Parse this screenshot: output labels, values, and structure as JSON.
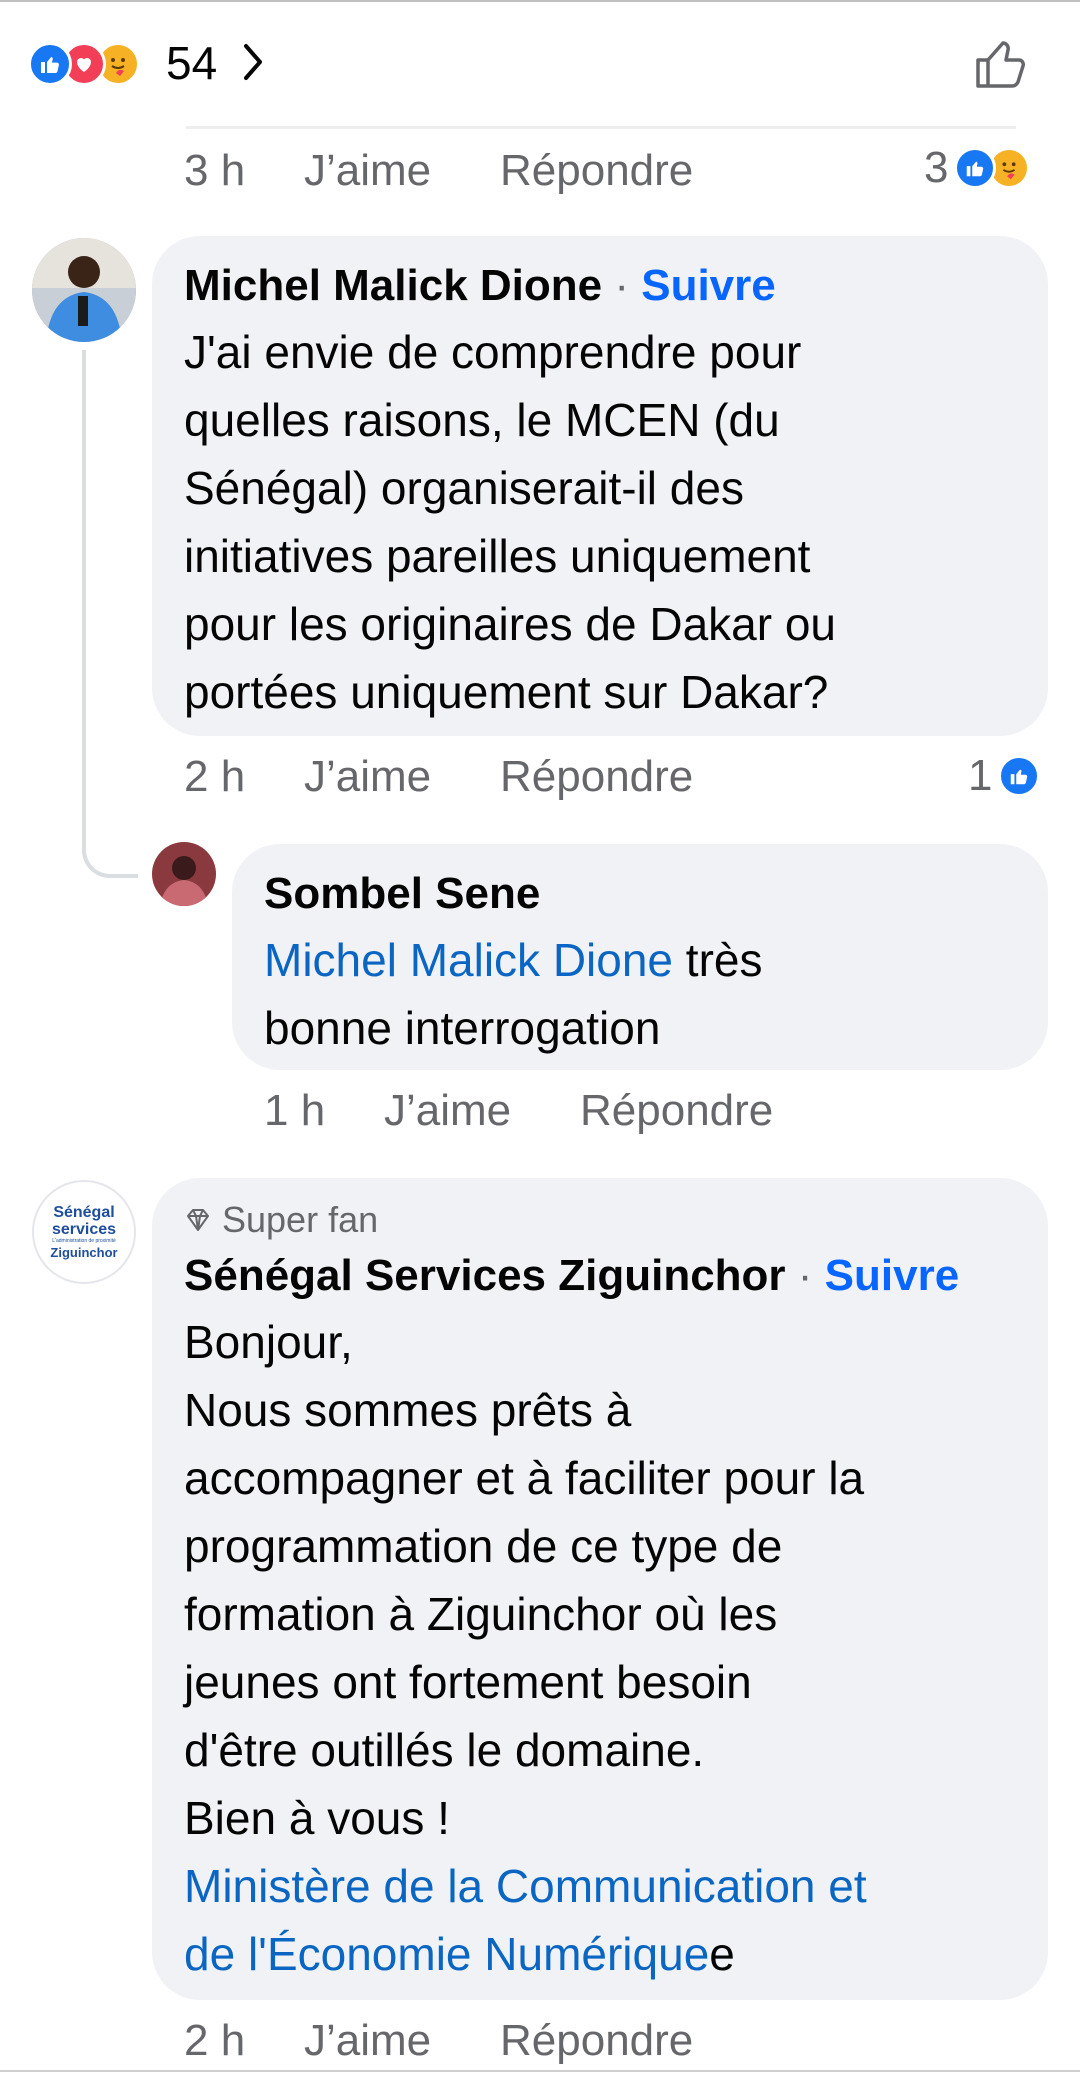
{
  "header": {
    "reaction_count": "54",
    "reaction_icons": [
      "like-icon",
      "love-icon",
      "care-icon"
    ]
  },
  "comments": [
    {
      "meta": {
        "time": "3 h",
        "like": "J’aime",
        "reply": "Répondre"
      },
      "reactions": {
        "count": "3",
        "icons": [
          "like-icon",
          "care-icon"
        ]
      }
    },
    {
      "author": "Michel Malick Dione",
      "separator": "·",
      "follow": "Suivre",
      "lines": [
        "J'ai envie de comprendre pour",
        "quelles raisons, le MCEN (du",
        "Sénégal) organiserait-il des",
        "initiatives pareilles uniquement",
        "pour les originaires de Dakar ou",
        "portées uniquement sur Dakar?"
      ],
      "meta": {
        "time": "2 h",
        "like": "J’aime",
        "reply": "Répondre"
      },
      "reactions": {
        "count": "1",
        "icons": [
          "like-icon"
        ]
      }
    },
    {
      "author": "Sombel Sene",
      "mention": "Michel Malick Dione",
      "line1_rest": " très",
      "line2": "bonne interrogation",
      "meta": {
        "time": "1 h",
        "like": "J’aime",
        "reply": "Répondre"
      }
    },
    {
      "badge": "Super fan",
      "author": "Sénégal Services Ziguinchor",
      "separator": "·",
      "follow": "Suivre",
      "avatar_logo": {
        "line1": "Sénégal",
        "line2": "services",
        "tag": "L'administration de proximité",
        "city": "Ziguinchor"
      },
      "lines": [
        "Bonjour,",
        "Nous sommes prêts à",
        "accompagner et à faciliter pour la",
        "programmation de ce type de",
        "formation à Ziguinchor où les",
        "jeunes ont fortement besoin",
        "d'être outillés le domaine.",
        "Bien à vous !"
      ],
      "mention_line1": "Ministère de la Communication et",
      "mention_line2": "de l'Économie Numérique",
      "mention_tail": "e",
      "meta": {
        "time": "2 h",
        "like": "J’aime",
        "reply": "Répondre"
      }
    }
  ],
  "colors": {
    "like_blue": "#1877f2",
    "love_red": "#f33e58",
    "care_yellow": "#f7b125",
    "link_blue": "#0a66c2",
    "follow_blue": "#0866ff",
    "bubble_bg": "#f0f2f5",
    "meta_gray": "#65676b"
  }
}
